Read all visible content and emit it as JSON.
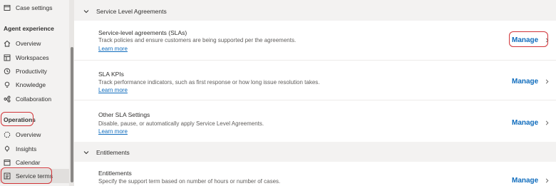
{
  "sidebar": {
    "case_settings": "Case settings",
    "agent_experience_header": "Agent experience",
    "agent_items": [
      {
        "label": "Overview",
        "icon": "home-icon"
      },
      {
        "label": "Workspaces",
        "icon": "workspaces-icon"
      },
      {
        "label": "Productivity",
        "icon": "productivity-icon"
      },
      {
        "label": "Knowledge",
        "icon": "knowledge-icon"
      },
      {
        "label": "Collaboration",
        "icon": "collaboration-icon"
      }
    ],
    "operations_header": "Operations",
    "operations_items": [
      {
        "label": "Overview",
        "icon": "overview-icon"
      },
      {
        "label": "Insights",
        "icon": "insights-icon"
      },
      {
        "label": "Calendar",
        "icon": "calendar-icon"
      },
      {
        "label": "Service terms",
        "icon": "service-terms-icon"
      }
    ]
  },
  "main": {
    "sla_section": {
      "title": "Service Level Agreements",
      "rows": [
        {
          "title": "Service-level agreements (SLAs)",
          "desc": "Track policies and ensure customers are being supported per the agreements.",
          "link": "Learn more",
          "action": "Manage"
        },
        {
          "title": "SLA KPIs",
          "desc": "Track performance indicators, such as first response or how long issue resolution takes.",
          "link": "Learn more",
          "action": "Manage"
        },
        {
          "title": "Other SLA Settings",
          "desc": "Disable, pause, or automatically apply Service Level Agreements.",
          "link": "Learn more",
          "action": "Manage"
        }
      ]
    },
    "entitlements_section": {
      "title": "Entitlements",
      "rows": [
        {
          "title": "Entitlements",
          "desc": "Specify the support term based on number of hours or number of cases.",
          "action": "Manage"
        }
      ]
    }
  },
  "colors": {
    "accent": "#0f6cbd",
    "highlight": "#d13438",
    "selected_bg": "#e1dfdd"
  }
}
